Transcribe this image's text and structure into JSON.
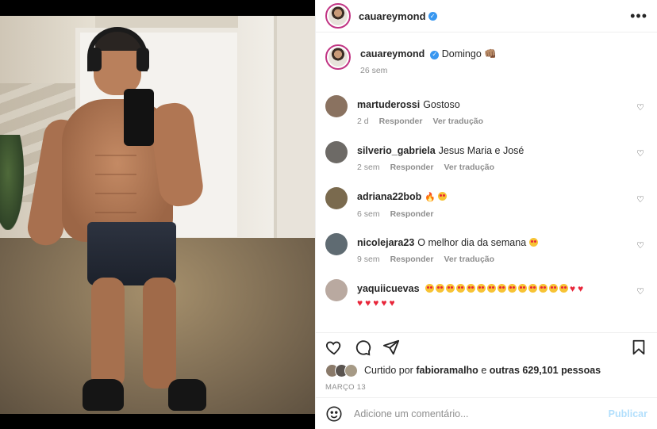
{
  "post": {
    "author": "cauareymond",
    "verified": true,
    "more_icon": "more-horizontal-icon"
  },
  "caption": {
    "username": "cauareymond",
    "text": "Domingo",
    "emoji": "👊🏽",
    "time": "26 sem"
  },
  "comments": [
    {
      "username": "martuderossi",
      "text": "Gostoso",
      "time": "2 d",
      "reply": "Responder",
      "translate": "Ver tradução",
      "avatar_color": "#8a7260"
    },
    {
      "username": "silverio_gabriela",
      "text": "Jesus Maria e José",
      "time": "2 sem",
      "reply": "Responder",
      "translate": "Ver tradução",
      "avatar_color": "#6d6a66"
    },
    {
      "username": "adriana22bob",
      "text": "",
      "time": "6 sem",
      "reply": "Responder",
      "translate": "",
      "avatar_color": "#7a6a4e"
    },
    {
      "username": "nicolejara23",
      "text": "O melhor dia da semana",
      "time": "9 sem",
      "reply": "Responder",
      "translate": "Ver tradução",
      "avatar_color": "#5f6b72"
    },
    {
      "username": "yaquiicuevas",
      "text": "",
      "time": "",
      "reply": "",
      "translate": "",
      "avatar_color": "#b9a9a0"
    }
  ],
  "likes": {
    "prefix": "Curtido por",
    "user": "fabioramalho",
    "middle": "e",
    "others": "outras 629,101 pessoas"
  },
  "date": "MARÇO 13",
  "add_comment": {
    "placeholder": "Adicione um comentário...",
    "publish_label": "Publicar"
  },
  "colors": {
    "verified": "#3897f0",
    "story_ring": "#c13584",
    "publish_disabled": "#b2dffc",
    "meta_gray": "#8e8e8e"
  }
}
